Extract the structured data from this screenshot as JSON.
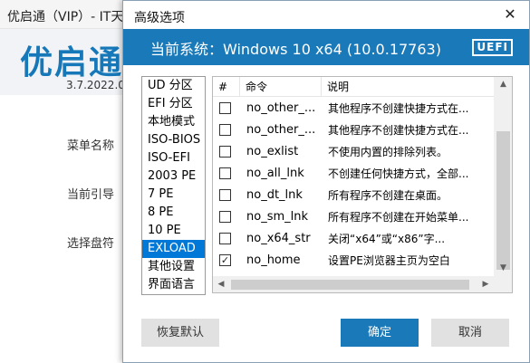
{
  "background_window": {
    "title": "优启通（VIP）- IT天",
    "logo": "优启通",
    "version": "3.7.2022.0",
    "labels": [
      "菜单名称",
      "当前引导",
      "选择盘符"
    ]
  },
  "dialog": {
    "title": "高级选项",
    "close_icon": "close-icon",
    "current_system": "当前系统：Windows 10 x64 (10.0.17763)",
    "boot_badge": "UEFI",
    "header_color": "#1a79b8",
    "categories": [
      {
        "label": "UD 分区",
        "selected": false
      },
      {
        "label": "EFI 分区",
        "selected": false
      },
      {
        "label": "本地模式",
        "selected": false
      },
      {
        "label": "ISO-BIOS",
        "selected": false
      },
      {
        "label": "ISO-EFI",
        "selected": false
      },
      {
        "label": "2003 PE",
        "selected": false
      },
      {
        "label": "7 PE",
        "selected": false
      },
      {
        "label": "8 PE",
        "selected": false
      },
      {
        "label": "10 PE",
        "selected": false
      },
      {
        "label": "EXLOAD",
        "selected": true
      },
      {
        "label": "其他设置",
        "selected": false
      },
      {
        "label": "界面语言",
        "selected": false
      }
    ],
    "table": {
      "headers": {
        "index": "#",
        "command": "命令",
        "description": "说明"
      },
      "rows": [
        {
          "checked": false,
          "command": "no_other_...",
          "description": "其他程序不创建快捷方式在..."
        },
        {
          "checked": false,
          "command": "no_other_...",
          "description": "其他程序不创建快捷方式在..."
        },
        {
          "checked": false,
          "command": "no_exlist",
          "description": "不使用内置的排除列表。"
        },
        {
          "checked": false,
          "command": "no_all_lnk",
          "description": "不创建任何快捷方式，全部..."
        },
        {
          "checked": false,
          "command": "no_dt_lnk",
          "description": "所有程序不创建在桌面。"
        },
        {
          "checked": false,
          "command": "no_sm_lnk",
          "description": "所有程序不创建在开始菜单..."
        },
        {
          "checked": false,
          "command": "no_x64_str",
          "description": "关闭“x64”或“x86”字..."
        },
        {
          "checked": true,
          "command": "no_home",
          "description": "设置PE浏览器主页为空白"
        }
      ]
    },
    "buttons": {
      "reset": "恢复默认",
      "ok": "确定",
      "cancel": "取消"
    },
    "accent_color": "#1a79b8",
    "selection_color": "#0078d7"
  }
}
